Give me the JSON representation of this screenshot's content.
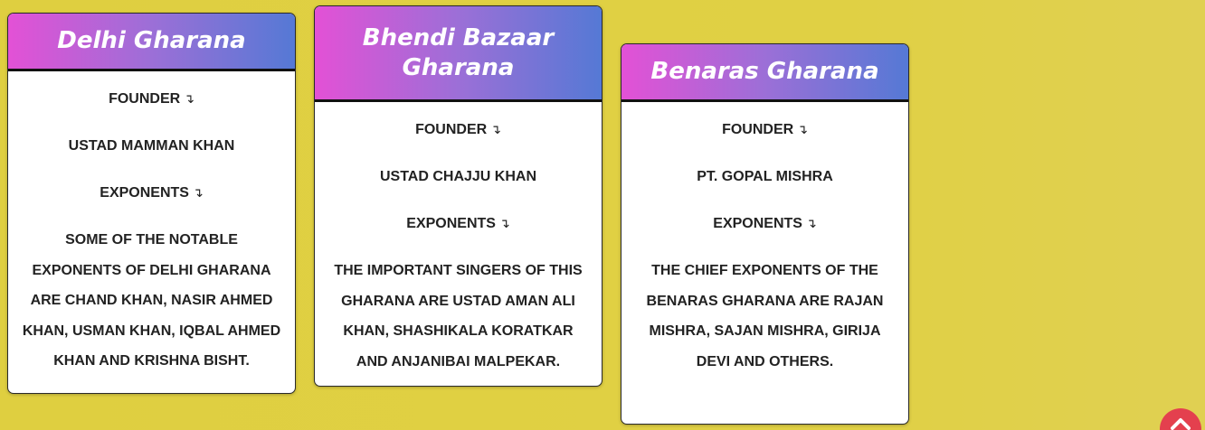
{
  "cards": [
    {
      "title": "Delhi Gharana",
      "founder_label": "FOUNDER",
      "founder_name": "USTAD MAMMAN KHAN",
      "exponents_label": "EXPONENTS",
      "description": "SOME OF THE NOTABLE EXPONENTS OF DELHI GHARANA ARE CHAND KHAN, NASIR AHMED KHAN, USMAN KHAN, IQBAL AHMED KHAN AND KRISHNA BISHT."
    },
    {
      "title": "Bhendi Bazaar Gharana",
      "founder_label": "FOUNDER",
      "founder_name": "USTAD CHAJJU KHAN",
      "exponents_label": "EXPONENTS",
      "description": "THE IMPORTANT SINGERS OF THIS GHARANA ARE USTAD AMAN ALI KHAN, SHASHIKALA KORATKAR AND ANJANIBAI MALPEKAR."
    },
    {
      "title": "Benaras Gharana",
      "founder_label": "FOUNDER",
      "founder_name": "PT. GOPAL MISHRA",
      "exponents_label": "EXPONENTS",
      "description": "THE CHIEF EXPONENTS OF THE BENARAS GHARANA ARE RAJAN MISHRA, SAJAN MISHRA, GIRIJA DEVI AND OTHERS."
    }
  ],
  "arrow_glyph": "↴",
  "colors": {
    "background": "#dfcf40",
    "header_gradient_start": "#e351d6",
    "header_gradient_end": "#5579d5",
    "scroll_button": "#e4404e"
  },
  "icons": {
    "scroll_top": "chevron-up-icon",
    "label_arrow": "arrow-down-right-icon"
  }
}
